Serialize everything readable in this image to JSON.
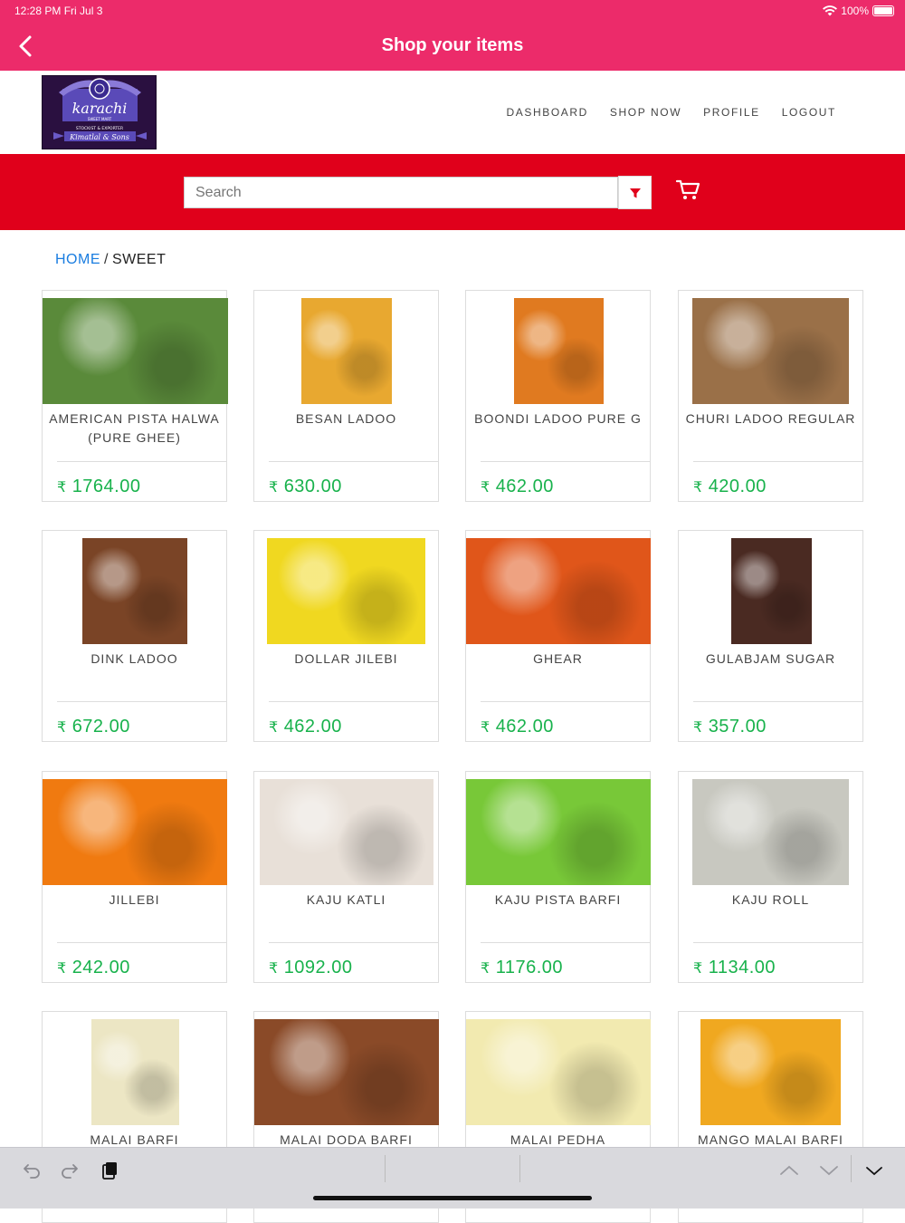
{
  "status": {
    "time": "12:28 PM   Fri Jul 3",
    "battery": "100%"
  },
  "nav": {
    "title": "Shop your items"
  },
  "logo": {
    "brand": "karachi",
    "line2": "SWEET MART",
    "line3": "STOCKIST & EXPORTER",
    "line4": "Kimatlal & Sons"
  },
  "menu": [
    "DASHBOARD",
    "SHOP NOW",
    "PROFILE",
    "LOGOUT"
  ],
  "search": {
    "placeholder": "Search"
  },
  "breadcrumb": {
    "home": "HOME",
    "sep": "/",
    "current": "SWEET"
  },
  "currency": "₹",
  "products": [
    {
      "name": "AMERICAN PISTA HALWA (PURE GHEE)",
      "price": "1764.00",
      "color": "#5a8a3a"
    },
    {
      "name": "BESAN LADOO",
      "price": "630.00",
      "color": "#e8a830"
    },
    {
      "name": "BOONDI LADOO PURE G",
      "price": "462.00",
      "color": "#e07a20"
    },
    {
      "name": "CHURI LADOO REGULAR",
      "price": "420.00",
      "color": "#9a7048"
    },
    {
      "name": "DINK LADOO",
      "price": "672.00",
      "color": "#7a4426"
    },
    {
      "name": "DOLLAR JILEBI",
      "price": "462.00",
      "color": "#f0d820"
    },
    {
      "name": "GHEAR",
      "price": "462.00",
      "color": "#e0561a"
    },
    {
      "name": "GULABJAM SUGAR",
      "price": "357.00",
      "color": "#4a2a22"
    },
    {
      "name": "JILLEBI",
      "price": "242.00",
      "color": "#f07a10"
    },
    {
      "name": "KAJU KATLI",
      "price": "1092.00",
      "color": "#e8e0d8"
    },
    {
      "name": "KAJU PISTA BARFI",
      "price": "1176.00",
      "color": "#78c838"
    },
    {
      "name": "KAJU ROLL",
      "price": "1134.00",
      "color": "#c8c8c0"
    },
    {
      "name": "MALAI BARFI",
      "price": "",
      "color": "#ece6c4"
    },
    {
      "name": "MALAI DODA BARFI",
      "price": "",
      "color": "#8a4a28"
    },
    {
      "name": "MALAI PEDHA",
      "price": "",
      "color": "#f2eab0"
    },
    {
      "name": "MANGO MALAI BARFI",
      "price": "",
      "color": "#f0a820"
    }
  ],
  "colors": {
    "accent": "#ec2b6a",
    "search_band": "#e0001b",
    "price": "#18b24c",
    "link": "#1a7de0"
  }
}
